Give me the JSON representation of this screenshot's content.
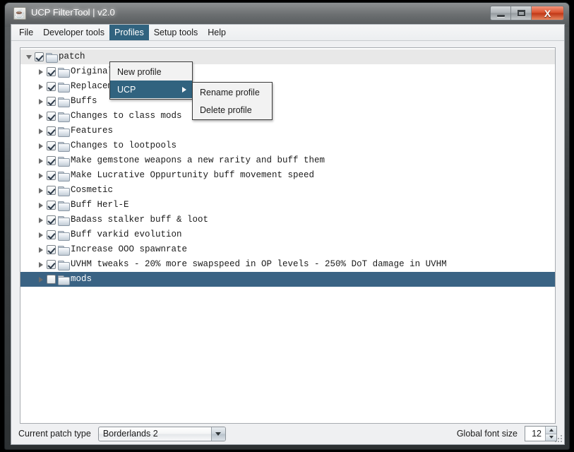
{
  "window": {
    "title": "UCP FilterTool | v2.0",
    "icon": "java-coffee-icon",
    "controls": {
      "minimize": "minimize-button",
      "maximize": "maximize-button",
      "close_label": "X"
    }
  },
  "menubar": {
    "items": [
      {
        "label": "File",
        "active": false
      },
      {
        "label": "Developer tools",
        "active": false
      },
      {
        "label": "Profiles",
        "active": true
      },
      {
        "label": "Setup tools",
        "active": false
      },
      {
        "label": "Help",
        "active": false
      }
    ]
  },
  "profiles_menu": {
    "items": [
      {
        "label": "New profile",
        "highlight": false,
        "submenu": false
      },
      {
        "label": "UCP",
        "highlight": true,
        "submenu": true
      }
    ]
  },
  "ucp_submenu": {
    "items": [
      {
        "label": "Rename profile"
      },
      {
        "label": "Delete profile"
      }
    ]
  },
  "tree": {
    "rows": [
      {
        "label": "patch",
        "depth": 0,
        "checked": true,
        "expanded": true,
        "selected": false,
        "root_selected": true
      },
      {
        "label": "Original                   check",
        "depth": 1,
        "checked": true,
        "expanded": false,
        "selected": false,
        "root_selected": false
      },
      {
        "label": "Replacements",
        "depth": 1,
        "checked": true,
        "expanded": false,
        "selected": false,
        "root_selected": false
      },
      {
        "label": "Buffs",
        "depth": 1,
        "checked": true,
        "expanded": false,
        "selected": false,
        "root_selected": false
      },
      {
        "label": "Changes to class mods",
        "depth": 1,
        "checked": true,
        "expanded": false,
        "selected": false,
        "root_selected": false
      },
      {
        "label": "Features",
        "depth": 1,
        "checked": true,
        "expanded": false,
        "selected": false,
        "root_selected": false
      },
      {
        "label": "Changes to lootpools",
        "depth": 1,
        "checked": true,
        "expanded": false,
        "selected": false,
        "root_selected": false
      },
      {
        "label": "Make gemstone weapons a new rarity and buff them",
        "depth": 1,
        "checked": true,
        "expanded": false,
        "selected": false,
        "root_selected": false
      },
      {
        "label": "Make Lucrative Oppurtunity buff movement speed",
        "depth": 1,
        "checked": true,
        "expanded": false,
        "selected": false,
        "root_selected": false
      },
      {
        "label": "Cosmetic",
        "depth": 1,
        "checked": true,
        "expanded": false,
        "selected": false,
        "root_selected": false
      },
      {
        "label": "Buff Herl-E",
        "depth": 1,
        "checked": true,
        "expanded": false,
        "selected": false,
        "root_selected": false
      },
      {
        "label": "Badass stalker buff & loot",
        "depth": 1,
        "checked": true,
        "expanded": false,
        "selected": false,
        "root_selected": false
      },
      {
        "label": "Buff varkid evolution",
        "depth": 1,
        "checked": true,
        "expanded": false,
        "selected": false,
        "root_selected": false
      },
      {
        "label": "Increase OOO spawnrate",
        "depth": 1,
        "checked": true,
        "expanded": false,
        "selected": false,
        "root_selected": false
      },
      {
        "label": "UVHM tweaks - 20% more swapspeed in OP levels - 250% DoT damage in UVHM",
        "depth": 1,
        "checked": true,
        "expanded": false,
        "selected": false,
        "root_selected": false
      },
      {
        "label": "mods",
        "depth": 1,
        "checked": false,
        "expanded": false,
        "selected": true,
        "root_selected": false
      }
    ]
  },
  "bottombar": {
    "patch_type_label": "Current patch type",
    "patch_type_value": "Borderlands 2",
    "font_size_label": "Global font size",
    "font_size_value": "12"
  },
  "colors": {
    "menu_highlight": "#31637f",
    "row_selected": "#3a6384",
    "close_button": "#d9502c",
    "client_background": "#eff0f2",
    "tree_background": "#ffffff"
  }
}
